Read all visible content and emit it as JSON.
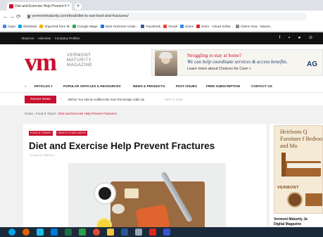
{
  "browser": {
    "tab_title": "Diet and Exercise Help Prevent F",
    "tab_close": "×",
    "new_tab": "+",
    "url": "vermontmaturity.com/food/diet-to-eat-food-and-fractures/",
    "nav": {
      "back": "←",
      "forward": "→",
      "reload": "⟳",
      "home": "⌂"
    },
    "bookmarks": [
      {
        "label": "Apps",
        "color": "#4285f4"
      },
      {
        "label": "Windows",
        "color": "#00a4ef"
      },
      {
        "label": "Imported from IE",
        "color": "#f4b400"
      },
      {
        "label": "Google Maps",
        "color": "#34a853"
      },
      {
        "label": "New Horizons Unde...",
        "color": "#1a73e8"
      },
      {
        "label": "Facebook",
        "color": "#3b5998"
      },
      {
        "label": "Gmail",
        "color": "#ea4335"
      },
      {
        "label": "Zoom",
        "color": "#2d8cff"
      },
      {
        "label": "Zoho - Cloud Softw...",
        "color": "#e42527"
      },
      {
        "label": "Client Area - Maxim...",
        "color": "#888888"
      }
    ]
  },
  "topbar": {
    "links": [
      "About Us",
      "Advertise",
      "Company Profiles"
    ],
    "social": "f ▪ ● ⊙"
  },
  "header": {
    "logo_mark": "vm",
    "logo_lines": [
      "VERMONT",
      "MATURITY",
      "MAGAZINE"
    ],
    "ad": {
      "line1": "Struggling to stay at home?",
      "line2": "We can help coordinate services & access benefits.",
      "line3": "Learn more about Choices for Care »",
      "brand": "AG"
    }
  },
  "mainnav": {
    "items": [
      "ARTICLES ▾",
      "POPULAR ARTICLES & RESOURCES",
      "NEWS & PRODUCTS",
      "PAST ISSUES",
      "FREE SUBSCRIPTION",
      "CONTACT US"
    ]
  },
  "recent": {
    "badge": "Recent News",
    "arrow": "›",
    "headline": "Before You Add an Addition Be Sure the Design Adds Up",
    "date": "•  MAY 5, 2020"
  },
  "breadcrumb": {
    "home": "Home",
    "section": "Food & Travel",
    "current": "Diet and Exercise Help Prevent Fractures",
    "sep": "›"
  },
  "article": {
    "tags": [
      "FOOD & TRAVEL",
      "HEALTH & WELLNESS"
    ],
    "title": "Diet and Exercise Help Prevent Fractures",
    "meta": "◷ June 22, 2020    ● 0"
  },
  "sidebar": {
    "ad_title": "Heirloom Q Furniture f Bedroom, and Mo",
    "ad_brand": "VERMONT",
    "caption_line1": "Vermont Maturity Ja",
    "caption_line2": "Digital Magazine"
  },
  "taskbar": {
    "icons": [
      {
        "name": "start",
        "color": "#00a4ef"
      },
      {
        "name": "firefox",
        "color": "#e66000"
      },
      {
        "name": "ie",
        "color": "#1ebbee"
      },
      {
        "name": "edge",
        "color": "#0078d7"
      },
      {
        "name": "excel",
        "color": "#1d6f42"
      },
      {
        "name": "app",
        "color": "#2d9d4b"
      },
      {
        "name": "chrome",
        "color": "#dd4b39"
      },
      {
        "name": "explorer",
        "color": "#f4c542"
      },
      {
        "name": "word",
        "color": "#2b579a"
      },
      {
        "name": "photos",
        "color": "#9aa7b8"
      },
      {
        "name": "acrobat",
        "color": "#e2231a"
      },
      {
        "name": "shield",
        "color": "#3355cc"
      }
    ]
  }
}
